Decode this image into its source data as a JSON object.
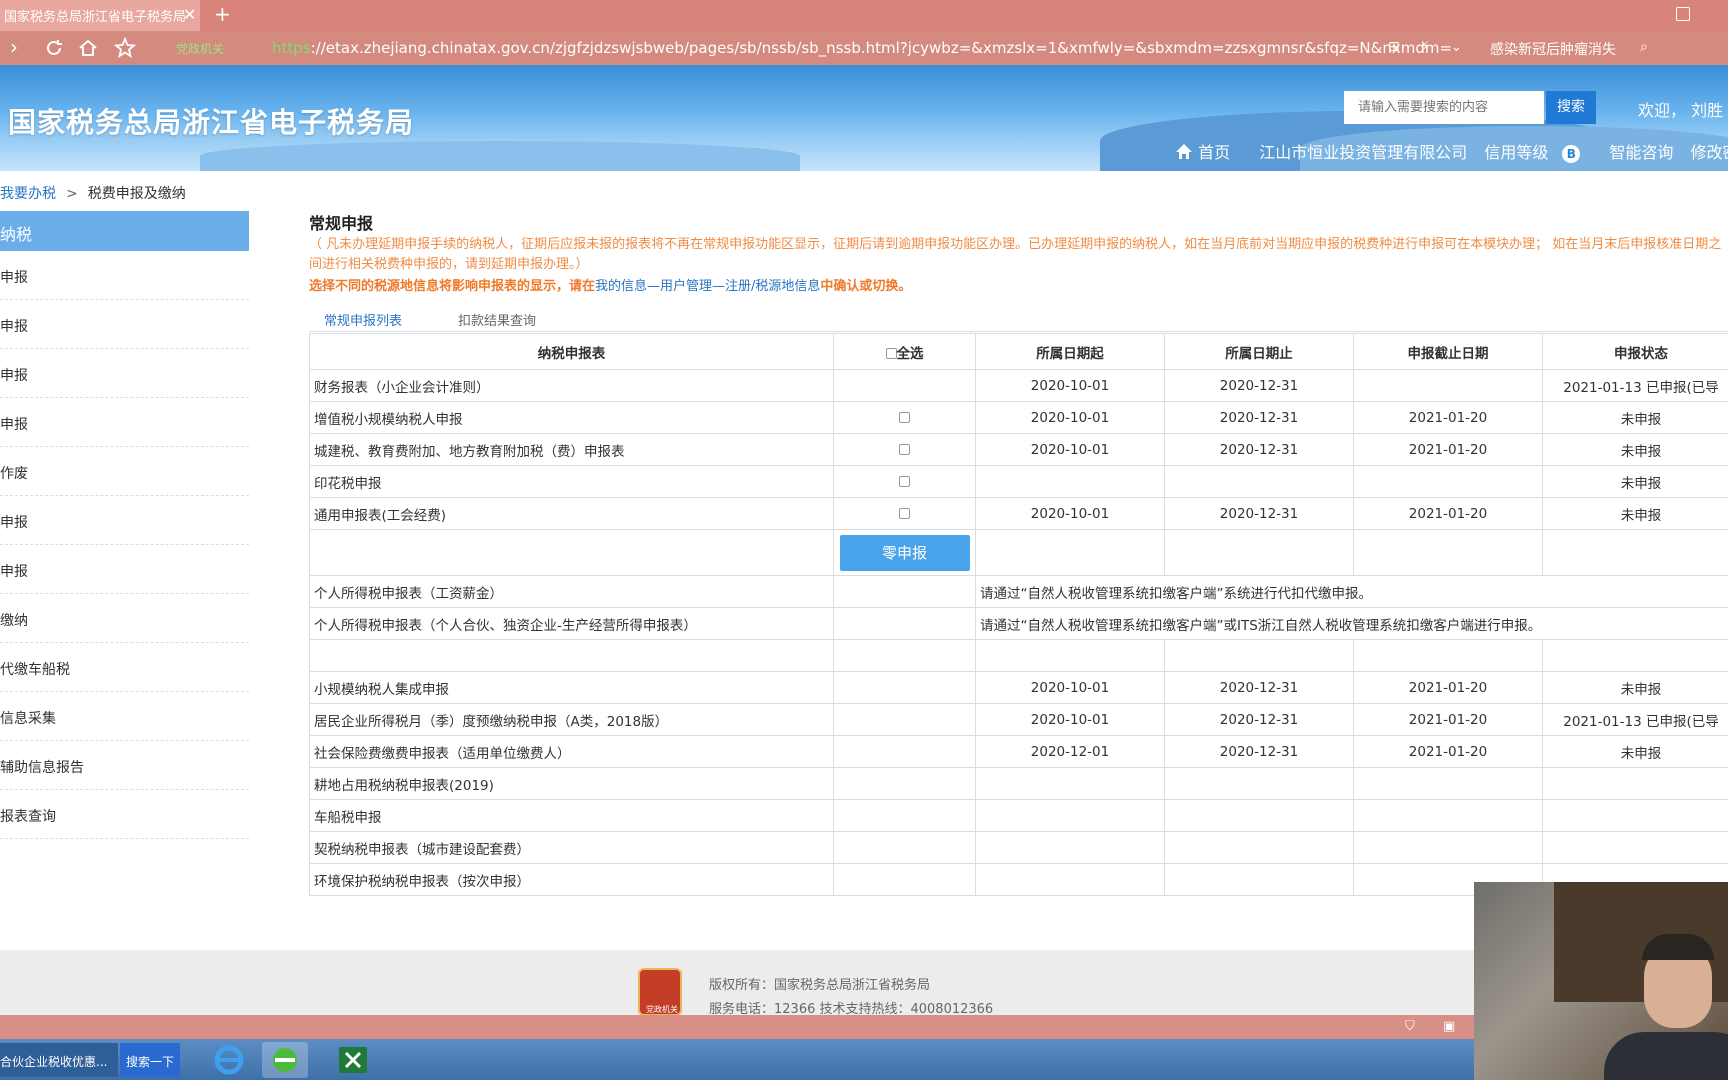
{
  "browser": {
    "tab_title": "国家税务总局浙江省电子税务局",
    "close_glyph": "✕",
    "new_tab_glyph": "+",
    "gov_tag": "党政机关",
    "url_scheme": "https",
    "url_rest": "://etax.zhejiang.chinatax.gov.cn/zjgfzjdzswjsbweb/pages/sb/nssb/sb_nssb.html?jcywbz=&xmzslx=1&xmfwly=&sbxmdm=zzsxgmnsr&sfqz=N&nxmdm=",
    "news_ticker": "感染新冠后肿瘤消失"
  },
  "header": {
    "site_title": "国家税务总局浙江省电子税务局",
    "search_placeholder": "请输入需要搜索的内容",
    "search_button": "搜索",
    "welcome": "欢迎， 刘胜",
    "nav_home": "首页",
    "company": "江山市恒业投资管理有限公司",
    "credit": "信用等级",
    "credit_grade": "B",
    "consult": "智能咨询",
    "change_password": "修改密码"
  },
  "breadcrumb": {
    "root": "我要办税",
    "sep": ">",
    "current": "税费申报及缴纳"
  },
  "sidebar": {
    "head": "纳税",
    "items": [
      "申报",
      "申报",
      "申报",
      "申报",
      "作废",
      "申报",
      "申报",
      "缴纳",
      "代缴车船税",
      "信息采集",
      "辅助信息报告",
      "报表查询"
    ]
  },
  "main": {
    "title": "常规申报",
    "notice1": "（ 凡未办理延期申报手续的纳税人，征期后应报未报的报表将不再在常规申报功能区显示，征期后请到逾期申报功能区办理。已办理延期申报的纳税人，如在当月底前对当期应申报的税费种进行申报可在本模块办理； 如在当月末后申报核准日期之间进行相关税费种申报的，请到延期申报办理。）",
    "notice2_prefix": "选择不同的税源地信息将影响申报表的显示，请在",
    "notice2_link": "我的信息—用户管理—注册/税源地信息",
    "notice2_suffix": "中确认或切换。",
    "tabs": [
      "常规申报列表",
      "扣款结果查询"
    ]
  },
  "table": {
    "headers": [
      "纳税申报表",
      "全选",
      "所属日期起",
      "所属日期止",
      "申报截止日期",
      "申报状态"
    ],
    "rows_top": [
      {
        "name": "财务报表（小企业会计准则）",
        "chk": false,
        "start": "2020-10-01",
        "end": "2020-12-31",
        "deadline": "",
        "status": "2021-01-13 已申报(已导"
      },
      {
        "name": "增值税小规模纳税人申报",
        "chk": true,
        "start": "2020-10-01",
        "end": "2020-12-31",
        "deadline": "2021-01-20",
        "status": "未申报"
      },
      {
        "name": "城建税、教育费附加、地方教育附加税（费）申报表",
        "chk": true,
        "start": "2020-10-01",
        "end": "2020-12-31",
        "deadline": "2021-01-20",
        "status": "未申报"
      },
      {
        "name": "印花税申报",
        "chk": true,
        "start": "",
        "end": "",
        "deadline": "",
        "status": "未申报"
      },
      {
        "name": "通用申报表(工会经费)",
        "chk": true,
        "start": "2020-10-01",
        "end": "2020-12-31",
        "deadline": "2021-01-20",
        "status": "未申报"
      }
    ],
    "zero_button": "零申报",
    "rows_note": [
      {
        "name": "个人所得税申报表（工资薪金）",
        "note": "请通过“自然人税收管理系统扣缴客户端”系统进行代扣代缴申报。"
      },
      {
        "name": "个人所得税申报表（个人合伙、独资企业-生产经营所得申报表）",
        "note": "请通过“自然人税收管理系统扣缴客户端”或ITS浙江自然人税收管理系统扣缴客户端进行申报。"
      }
    ],
    "rows_bottom": [
      {
        "name": "",
        "start": "",
        "end": "",
        "deadline": "",
        "status": ""
      },
      {
        "name": "小规模纳税人集成申报",
        "start": "2020-10-01",
        "end": "2020-12-31",
        "deadline": "2021-01-20",
        "status": "未申报"
      },
      {
        "name": "居民企业所得税月（季）度预缴纳税申报（A类，2018版）",
        "start": "2020-10-01",
        "end": "2020-12-31",
        "deadline": "2021-01-20",
        "status": "2021-01-13 已申报(已导"
      },
      {
        "name": "社会保险费缴费申报表（适用单位缴费人）",
        "start": "2020-12-01",
        "end": "2020-12-31",
        "deadline": "2021-01-20",
        "status": "未申报"
      },
      {
        "name": "耕地占用税纳税申报表(2019)",
        "start": "",
        "end": "",
        "deadline": "",
        "status": ""
      },
      {
        "name": "车船税申报",
        "start": "",
        "end": "",
        "deadline": "",
        "status": ""
      },
      {
        "name": "契税纳税申报表（城市建设配套费）",
        "start": "",
        "end": "",
        "deadline": "",
        "status": ""
      },
      {
        "name": "环境保护税纳税申报表（按次申报）",
        "start": "",
        "end": "",
        "deadline": "",
        "status": ""
      }
    ]
  },
  "footer": {
    "logo_text": "党政机关",
    "copyright": "版权所有：国家税务总局浙江省税务局",
    "service": "服务电话：12366 技术支持热线：4008012366"
  },
  "taskbar": {
    "window_title": "合伙企业税收优惠...",
    "search_button": "搜索一下"
  }
}
